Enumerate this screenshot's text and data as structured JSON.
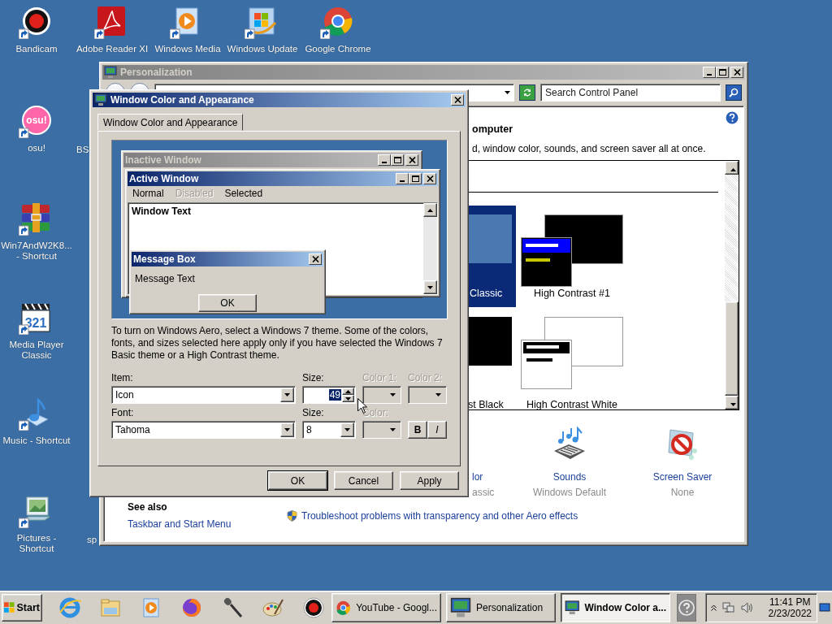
{
  "desktop_icons": [
    {
      "label": "Bandicam"
    },
    {
      "label": "Adobe Reader XI"
    },
    {
      "label": "Windows Media"
    },
    {
      "label": "Windows Update"
    },
    {
      "label": "Google Chrome"
    },
    {
      "label": "osu!",
      "logo_text": "osu!"
    },
    {
      "label": "BS"
    },
    {
      "label": "Win7AndW2K8...\n- Shortcut"
    },
    {
      "label": "Media Player\nClassic",
      "logo_text": "321"
    },
    {
      "label": "Music - Shortcut"
    },
    {
      "label": "Pictures - Shortcut"
    },
    {
      "label": "sp"
    }
  ],
  "personalization": {
    "title": "Personalization",
    "search": {
      "placeholder": "Search Control Panel"
    },
    "heading": "omputer",
    "description": "d, window color, sounds, and screen saver all at once.",
    "themes": [
      {
        "label": "Classic",
        "selected": true
      },
      {
        "label": "High Contrast #1",
        "selected": false
      },
      {
        "label": "st Black",
        "selected": false
      },
      {
        "label": "High Contrast White",
        "selected": false
      }
    ],
    "settings": [
      {
        "label": "lor",
        "value": "assic"
      },
      {
        "label": "Sounds",
        "value": "Windows Default"
      },
      {
        "label": "Screen Saver",
        "value": "None"
      }
    ],
    "see_also": {
      "title": "See also",
      "links": [
        "Taskbar and Start Menu"
      ]
    },
    "aero_link": "Troubleshoot problems with transparency and other Aero effects"
  },
  "dialog": {
    "title": "Window Color and Appearance",
    "tabs": [
      {
        "label": "Window Color and Appearance",
        "selected": true
      }
    ],
    "preview": {
      "inactive_title": "Inactive Window",
      "active_title": "Active Window",
      "menu": [
        {
          "label": "Normal",
          "disabled": false
        },
        {
          "label": "Disabled",
          "disabled": true
        },
        {
          "label": "Selected",
          "disabled": false
        }
      ],
      "window_text": "Window Text",
      "message_title": "Message Box",
      "message_text": "Message Text",
      "message_button": "OK"
    },
    "note": "To turn on Windows Aero, select a Windows 7 theme.  Some of the colors, fonts, and sizes selected here apply only if you have selected the Windows 7 Basic theme or a High Contrast theme.",
    "item": {
      "label": "Item:",
      "value": "Icon"
    },
    "item_size": {
      "label": "Size:",
      "value": "49"
    },
    "color_1": {
      "label": "Color 1:",
      "disabled": true
    },
    "color_2": {
      "label": "Color 2:",
      "disabled": true
    },
    "font": {
      "label": "Font:",
      "value": "Tahoma"
    },
    "font_size": {
      "label": "Size:",
      "value": "8"
    },
    "font_color": {
      "label": "Color:",
      "disabled": true
    },
    "bold": "B",
    "italic": "I",
    "buttons": [
      "OK",
      "Cancel",
      "Apply"
    ]
  },
  "taskbar": {
    "start": "Start",
    "tasks": [
      {
        "label": "YouTube - Googl...",
        "selected": false
      },
      {
        "label": "Personalization",
        "selected": false
      },
      {
        "label": "Window Color a...",
        "selected": true
      }
    ],
    "time": "11:41 PM",
    "date": "2/23/2022"
  }
}
